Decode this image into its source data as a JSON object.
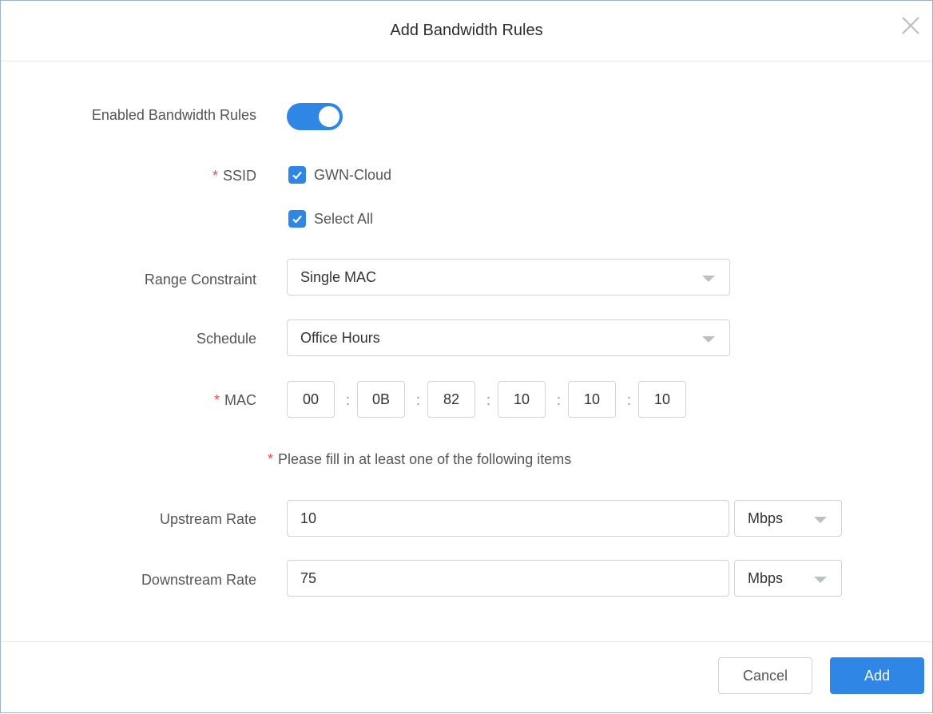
{
  "dialog": {
    "title": "Add Bandwidth Rules",
    "close_icon": "close-icon"
  },
  "form": {
    "enabled": {
      "label": "Enabled Bandwidth Rules",
      "value": true
    },
    "ssid": {
      "required_mark": "*",
      "label": "SSID",
      "options": [
        {
          "label": "GWN-Cloud",
          "checked": true
        },
        {
          "label": "Select All",
          "checked": true
        }
      ]
    },
    "range_constraint": {
      "label": "Range Constraint",
      "value": "Single MAC"
    },
    "schedule": {
      "label": "Schedule",
      "value": "Office Hours"
    },
    "mac": {
      "required_mark": "*",
      "label": "MAC",
      "octets": [
        "00",
        "0B",
        "82",
        "10",
        "10",
        "10"
      ],
      "separator": ":"
    },
    "note": {
      "mark": "*",
      "text": "Please fill in at least one of the following items"
    },
    "upstream": {
      "label": "Upstream Rate",
      "value": "10",
      "unit": "Mbps"
    },
    "downstream": {
      "label": "Downstream Rate",
      "value": "75",
      "unit": "Mbps"
    }
  },
  "footer": {
    "cancel_label": "Cancel",
    "add_label": "Add"
  },
  "colors": {
    "accent": "#2f86e5",
    "required": "#e64d4d",
    "border": "#cfd4da"
  }
}
